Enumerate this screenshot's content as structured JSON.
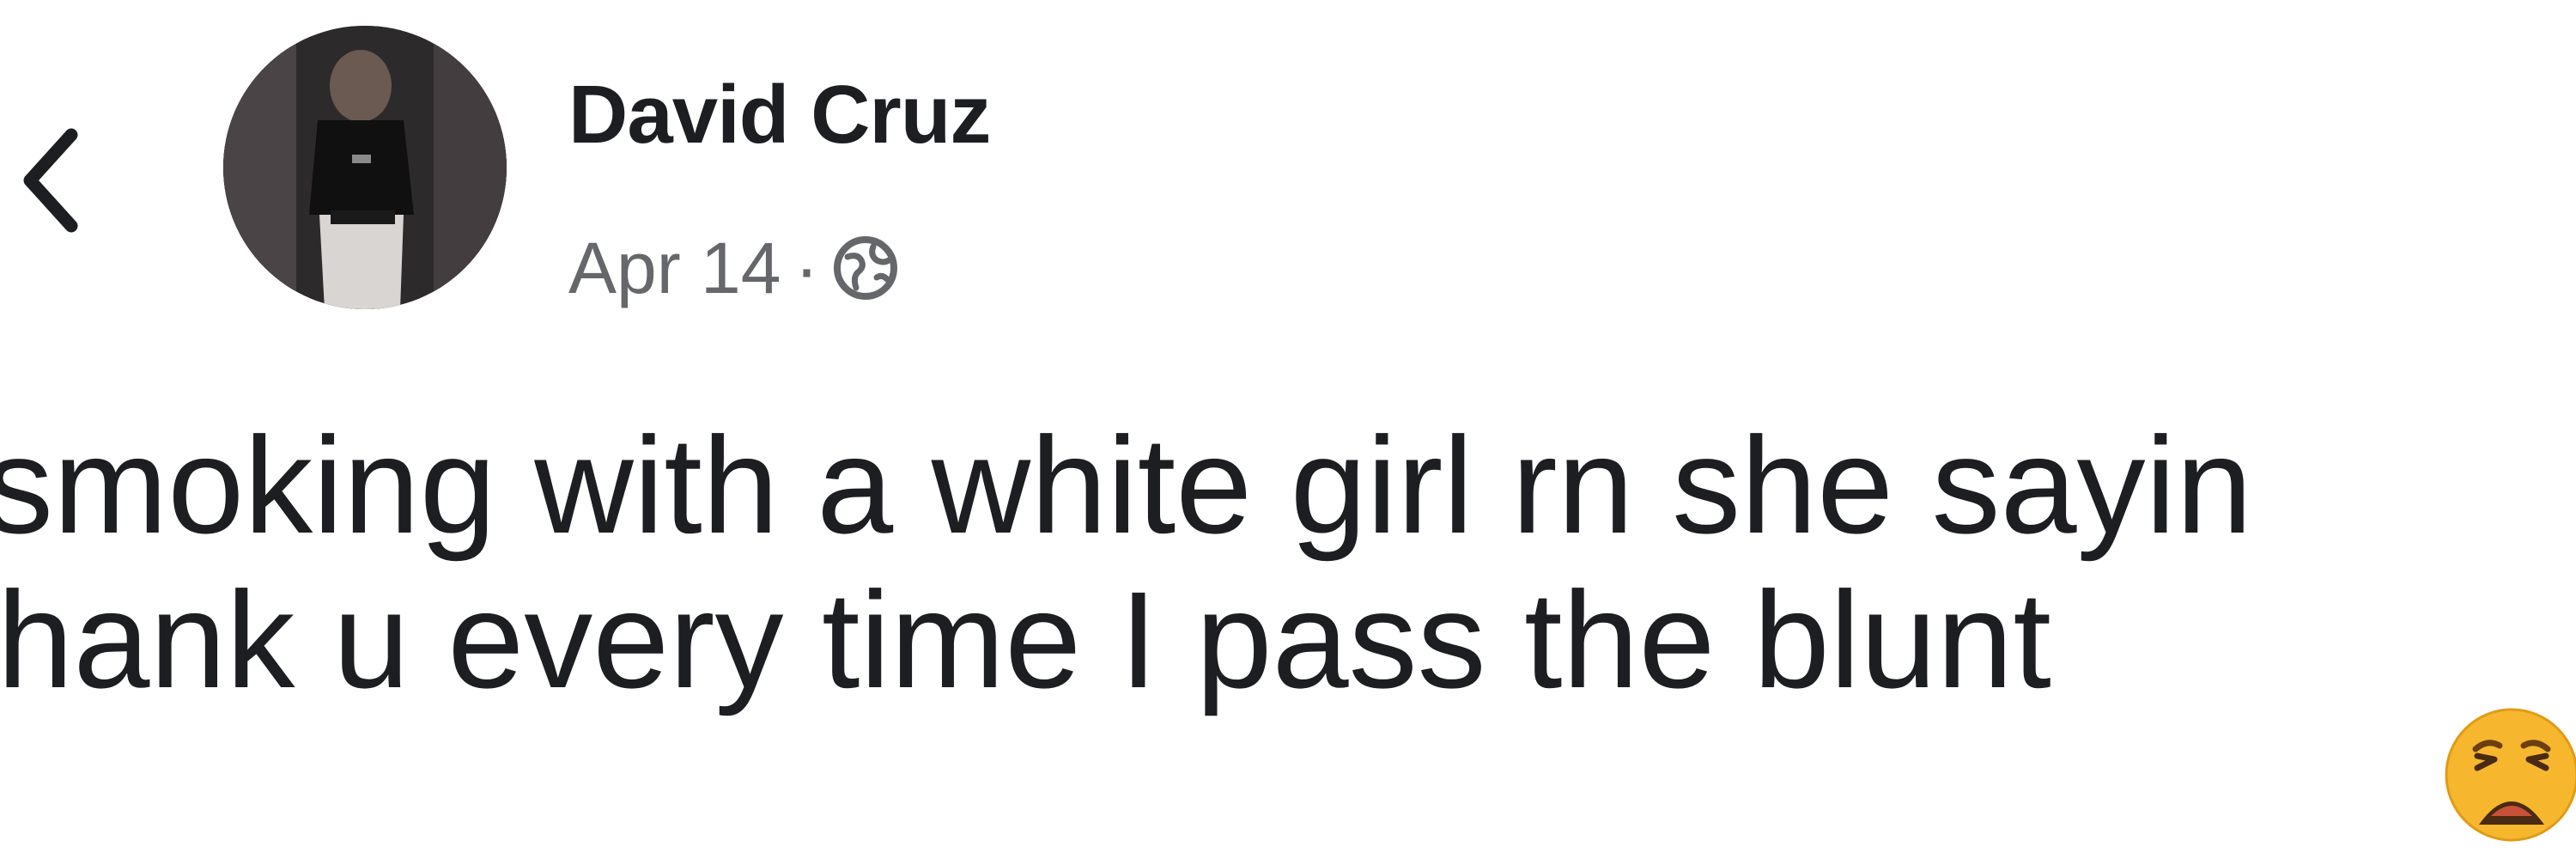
{
  "post": {
    "author_name": "David Cruz",
    "date": "Apr 14",
    "separator": "·",
    "privacy_icon": "globe-icon",
    "text_lines": [
      "smoking with a white girl rn she sayin",
      "thank u every time I pass the blunt"
    ],
    "emoji": "weary-face-emoji"
  },
  "navigation": {
    "back_icon": "chevron-left-icon"
  },
  "colors": {
    "primary_text": "#1c1e21",
    "secondary_text": "#65676b",
    "background": "#ffffff",
    "emoji_yellow": "#f6b72e"
  }
}
